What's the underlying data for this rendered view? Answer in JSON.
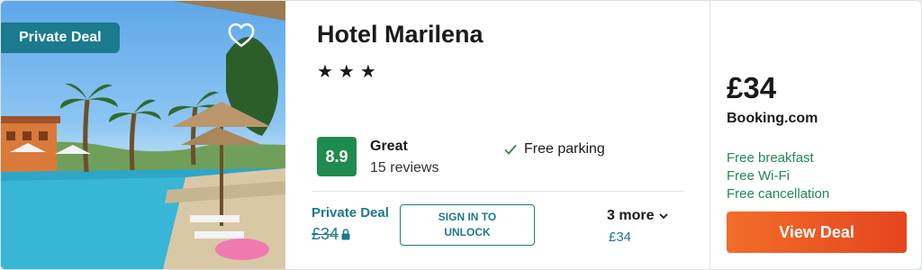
{
  "photo": {
    "badge": "Private Deal",
    "favorite_icon": "heart-outline-icon"
  },
  "hotel": {
    "name": "Hotel Marilena",
    "stars": 3,
    "stars_text": "★★★"
  },
  "rating": {
    "score": "8.9",
    "label": "Great",
    "reviews": "15 reviews",
    "badge_color": "#1f8b4d"
  },
  "amenity": {
    "icon": "check-icon",
    "text": "Free parking"
  },
  "private_deal": {
    "label": "Private Deal",
    "price": "£34",
    "lock_icon": "lock-icon",
    "button_line1": "SIGN IN TO",
    "button_line2": "UNLOCK"
  },
  "more_deals": {
    "label": "3 more",
    "price": "£34"
  },
  "offer": {
    "price": "£34",
    "provider": "Booking.com",
    "perks": [
      "Free breakfast",
      "Free Wi-Fi",
      "Free cancellation"
    ],
    "cta": "View Deal"
  },
  "colors": {
    "accent": "#1b7a8d",
    "perk_green": "#1f8b4d",
    "cta_orange": "#e5451d"
  }
}
